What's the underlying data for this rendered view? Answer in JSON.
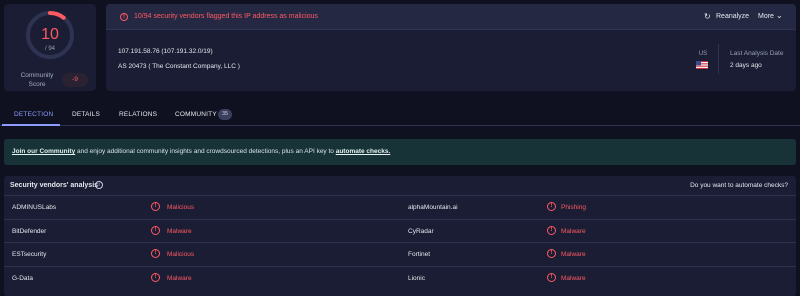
{
  "score": {
    "detections": "10",
    "total": "/ 94",
    "community_label": "Community Score",
    "community_score": "-9",
    "ratio": 0.1064
  },
  "alert": {
    "text": "10/94 security vendors flagged this IP address as malicious",
    "reanalyze": "Reanalyze",
    "more": "More"
  },
  "ip": {
    "address_line": "107.191.58.76  (107.191.32.0/19)",
    "as_line": "AS 20473  ( The Constant Company, LLC )",
    "country": "US",
    "last_analysis_label": "Last Analysis Date",
    "last_analysis_value": "2 days ago"
  },
  "tabs": [
    {
      "label": "DETECTION"
    },
    {
      "label": "DETAILS"
    },
    {
      "label": "RELATIONS"
    },
    {
      "label": "COMMUNITY"
    }
  ],
  "community_count": "35",
  "banner": {
    "link1": "Join our Community",
    "middle": " and enjoy additional community insights and crowdsourced detections, plus an API key to ",
    "link2": "automate checks."
  },
  "vendors": {
    "title": "Security vendors' analysis",
    "automate_q": "Do you want to automate checks?",
    "rows": [
      {
        "left_vendor": "ADMINUSLabs",
        "left_result": "Malicious",
        "right_vendor": "alphaMountain.ai",
        "right_result": "Phishing"
      },
      {
        "left_vendor": "BitDefender",
        "left_result": "Malware",
        "right_vendor": "CyRadar",
        "right_result": "Malware"
      },
      {
        "left_vendor": "ESTsecurity",
        "left_result": "Malicious",
        "right_vendor": "Fortinet",
        "right_result": "Malware"
      },
      {
        "left_vendor": "G-Data",
        "left_result": "Malware",
        "right_vendor": "Lionic",
        "right_result": "Malware"
      }
    ]
  },
  "colors": {
    "accent_red": "#ff5a62",
    "accent_blue": "#8c9cff",
    "background": "#0f1120",
    "panel": "#1a1d33"
  },
  "icons": {
    "alert": "alert-circle-icon",
    "reanalyze": "refresh-icon",
    "more": "chevron-down-icon",
    "info": "info-icon",
    "result": "alert-circle-icon",
    "flag": "us-flag-icon"
  }
}
